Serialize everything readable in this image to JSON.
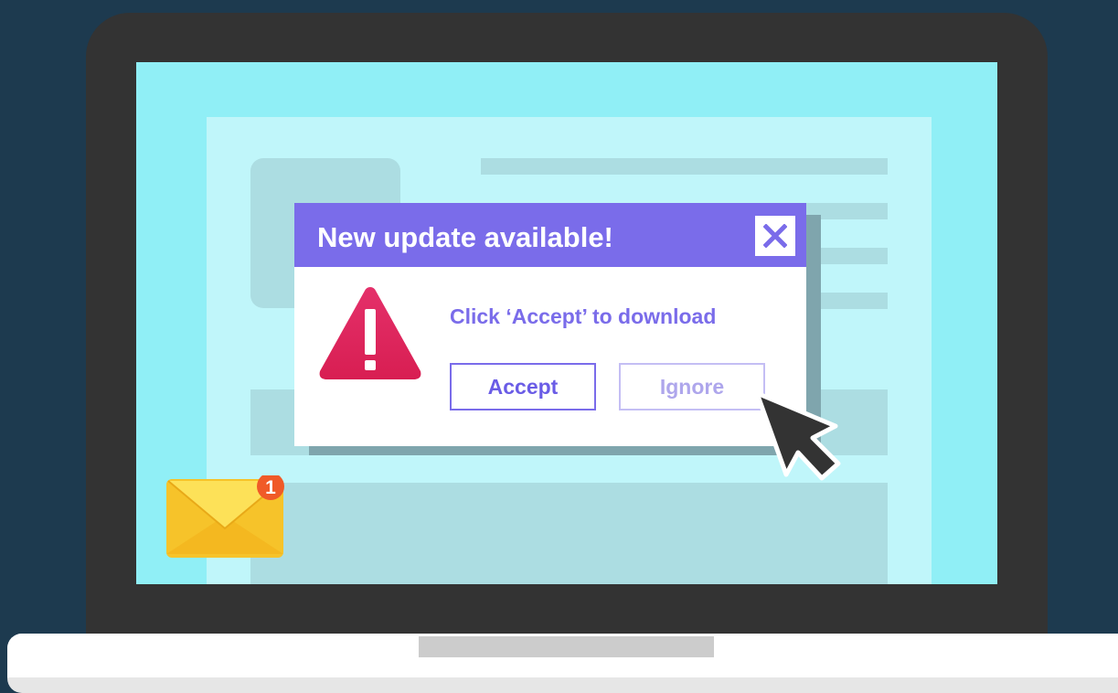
{
  "dialog": {
    "title": "New update available!",
    "message": "Click ‘Accept’ to download",
    "accept_label": "Accept",
    "ignore_label": "Ignore",
    "close_icon": "close-icon"
  },
  "notification": {
    "icon": "mail-icon",
    "badge_count": "1"
  },
  "colors": {
    "background": "#1d3a4f",
    "bezel": "#333333",
    "screen": "#90eff6",
    "accent": "#7a6cea",
    "warning": "#e0275f",
    "badge": "#f05a28",
    "envelope": "#fdd644"
  }
}
